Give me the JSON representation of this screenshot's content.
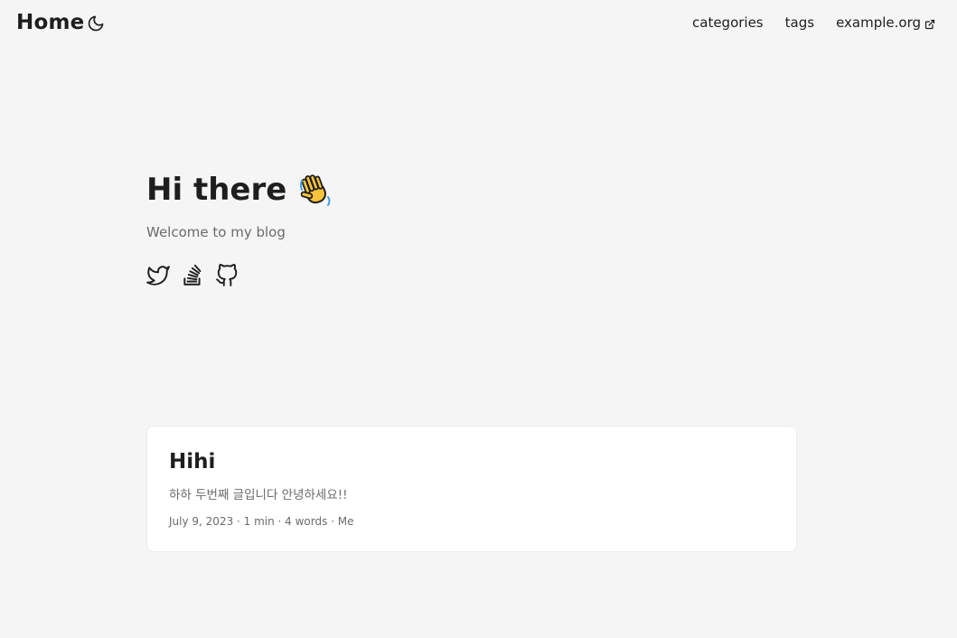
{
  "header": {
    "logo": "Home",
    "theme_toggle_icon": "moon-icon",
    "nav": [
      {
        "label": "categories"
      },
      {
        "label": "tags"
      },
      {
        "label": "example.org",
        "icon": "external-link-icon"
      }
    ]
  },
  "home": {
    "title": "Hi there",
    "title_icon": "waving-hand-icon",
    "subtitle": "Welcome to my blog",
    "social": [
      {
        "icon": "twitter-icon"
      },
      {
        "icon": "stackoverflow-icon"
      },
      {
        "icon": "github-icon"
      }
    ]
  },
  "posts": [
    {
      "title": "Hihi",
      "summary": "하하 두번째 글입니다 안녕하세요!!",
      "meta": "July 9, 2023 · 1 min · 4 words · Me"
    }
  ],
  "colors": {
    "background": "#f5f5f5",
    "card": "#ffffff",
    "text": "#1e1e1e",
    "secondary": "#6b6b6b"
  }
}
